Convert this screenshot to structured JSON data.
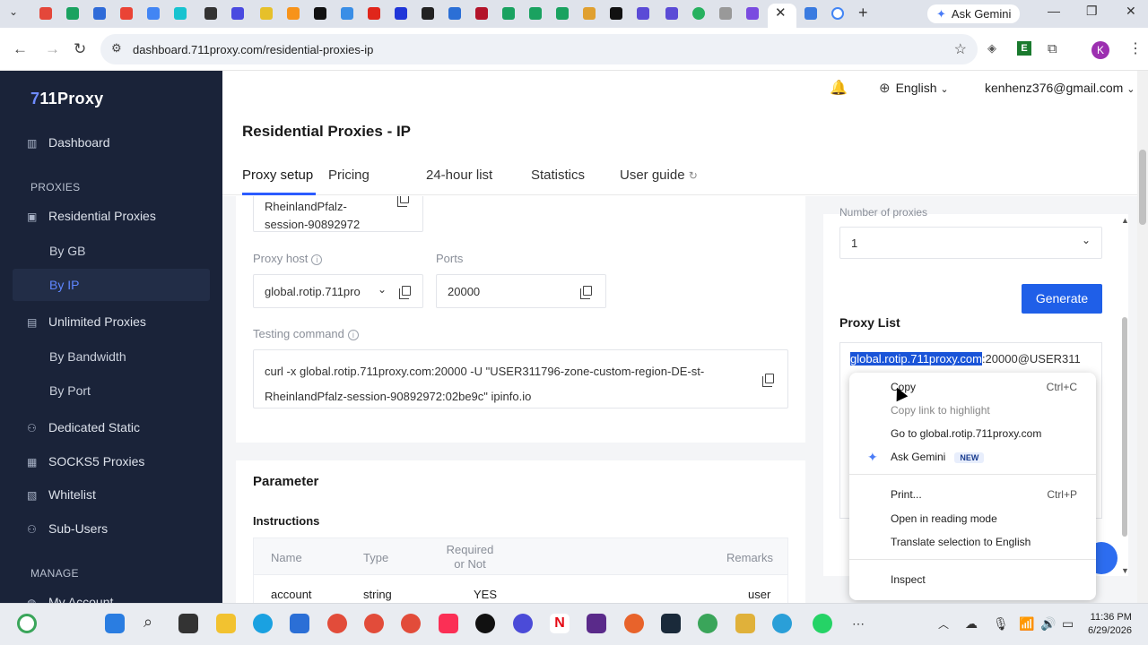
{
  "browser": {
    "active_tab_close": "✕",
    "new_tab": "+",
    "gemini_tab_label": "Ask Gemini",
    "url": "dashboard.711proxy.com/residential-proxies-ip",
    "profile_initial": "K"
  },
  "sidebar": {
    "logo_mark": "7",
    "logo_text": "11Proxy",
    "dashboard": "Dashboard",
    "section_proxies": "PROXIES",
    "residential": "Residential Proxies",
    "by_gb": "By GB",
    "by_ip": "By IP",
    "unlimited": "Unlimited Proxies",
    "by_bandwidth": "By Bandwidth",
    "by_port": "By Port",
    "dedicated": "Dedicated Static",
    "socks5": "SOCKS5 Proxies",
    "whitelist": "Whitelist",
    "subusers": "Sub-Users",
    "section_manage": "MANAGE",
    "my_account": "My Account"
  },
  "header": {
    "language": "English",
    "email": "kenhenz376@gmail.com"
  },
  "page": {
    "title": "Residential Proxies - IP",
    "tabs": [
      "Proxy setup",
      "Pricing",
      "24-hour list",
      "Statistics",
      "User guide"
    ]
  },
  "setup": {
    "username_line1": "RheinlandPfalz-",
    "username_line2": "session-90892972",
    "proxy_host_label": "Proxy host",
    "proxy_host_value": "global.rotip.711pro",
    "ports_label": "Ports",
    "ports_value": "20000",
    "testing_label": "Testing command",
    "cmd_line1": "curl -x global.rotip.711proxy.com:20000 -U \"USER311796-zone-custom-region-DE-st-",
    "cmd_line2": "RheinlandPfalz-session-90892972:02be9c\" ipinfo.io"
  },
  "parameter": {
    "title": "Parameter",
    "instructions": "Instructions",
    "columns": [
      "Name",
      "Type",
      "Required or Not",
      "Remarks"
    ],
    "rows": [
      {
        "name": "account",
        "type": "string",
        "required": "YES",
        "remarks": "user"
      }
    ]
  },
  "right_panel": {
    "count_label": "Number of proxies",
    "count_value": "1",
    "generate": "Generate",
    "proxy_list_title": "Proxy List",
    "proxy_selected": "global.rotip.711proxy.com",
    "proxy_rest": ":20000@USER311"
  },
  "context_menu": {
    "copy": "Copy",
    "copy_shortcut": "Ctrl+C",
    "copy_link": "Copy link to highlight",
    "goto": "Go to global.rotip.711proxy.com",
    "ask_gemini": "Ask Gemini",
    "new_badge": "NEW",
    "print": "Print...",
    "print_shortcut": "Ctrl+P",
    "reading_mode": "Open in reading mode",
    "translate": "Translate selection to English",
    "inspect": "Inspect"
  },
  "taskbar": {
    "time": "11:36 PM",
    "date": "6/29/2026"
  },
  "colors": {
    "sidebar_bg": "#1a2339",
    "accent": "#1f5fe8",
    "active_link": "#5f86ff"
  }
}
